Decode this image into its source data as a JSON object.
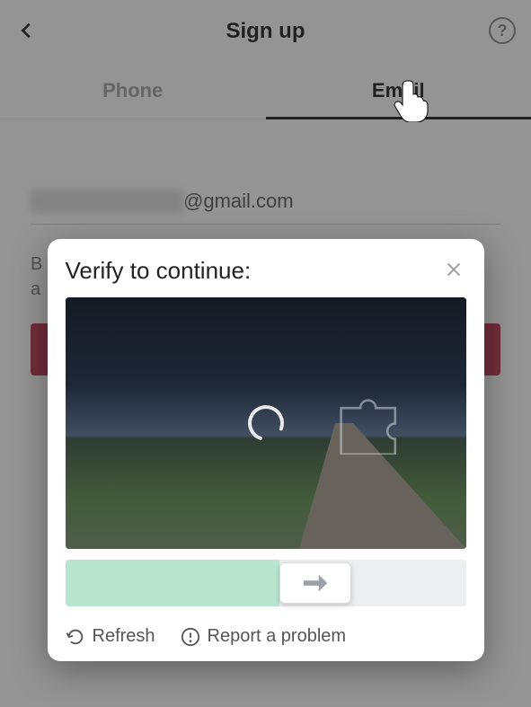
{
  "header": {
    "title": "Sign up"
  },
  "tabs": {
    "phone": "Phone",
    "email": "Email",
    "active": "email"
  },
  "email_input": {
    "domain_visible": "@gmail.com"
  },
  "terms_partial": {
    "line1": "B",
    "line2": "a"
  },
  "modal": {
    "title": "Verify to continue:",
    "refresh_label": "Refresh",
    "report_label": "Report a problem"
  }
}
